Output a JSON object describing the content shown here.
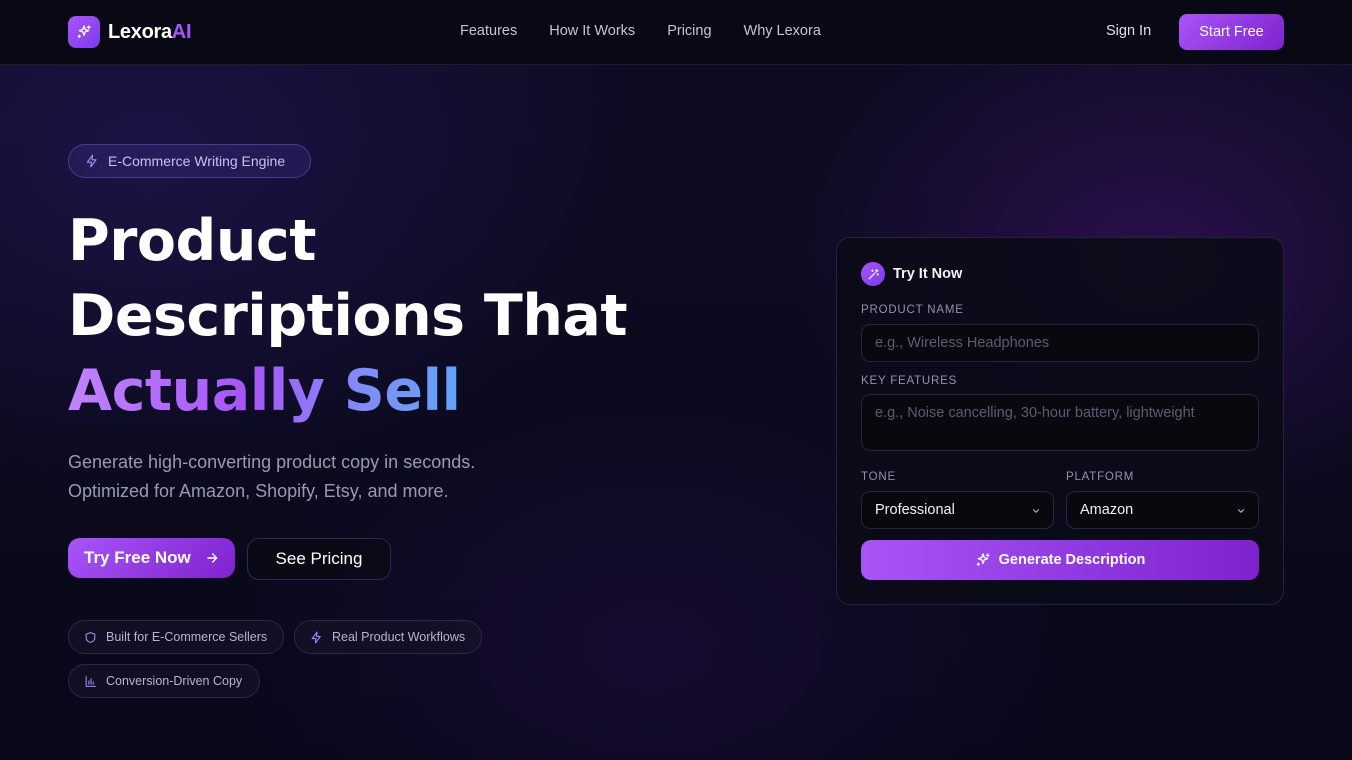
{
  "nav": {
    "logo_text": "Lexora",
    "logo_ai": "AI",
    "links": [
      "Features",
      "How It Works",
      "Pricing",
      "Why Lexora"
    ],
    "sign_in": "Sign In",
    "start_free": "Start Free"
  },
  "hero": {
    "badge": "E-Commerce Writing Engine",
    "headline_line1": "Product",
    "headline_line2": "Descriptions That",
    "headline_highlight": "Actually Sell",
    "sub_line1": "Generate high-converting product copy in seconds.",
    "sub_line2": "Optimized for Amazon, Shopify, Etsy, and more.",
    "cta_primary": "Try Free Now",
    "cta_secondary": "See Pricing",
    "chips": [
      "Built for E-Commerce Sellers",
      "Real Product Workflows",
      "Conversion-Driven Copy"
    ]
  },
  "card": {
    "title": "Try It Now",
    "product_name_label": "PRODUCT NAME",
    "product_name_placeholder": "e.g., Wireless Headphones",
    "key_features_label": "KEY FEATURES",
    "key_features_placeholder": "e.g., Noise cancelling, 30-hour battery, lightweight",
    "tone_label": "TONE",
    "tone_value": "Professional",
    "platform_label": "PLATFORM",
    "platform_value": "Amazon",
    "generate_button": "Generate Description"
  },
  "colors": {
    "accent": "#a855f7",
    "accent_dark": "#7e22ce",
    "background": "#0b0a1a"
  },
  "icons": {
    "logo": "sparkles-icon",
    "badge": "lightning-icon",
    "cta_primary": "arrow-right-icon",
    "chip_1": "shield-icon",
    "chip_2": "lightning-icon",
    "chip_3": "bar-chart-icon",
    "card_title": "magic-wand-icon",
    "select": "chevron-down-icon",
    "generate": "sparkles-icon"
  }
}
